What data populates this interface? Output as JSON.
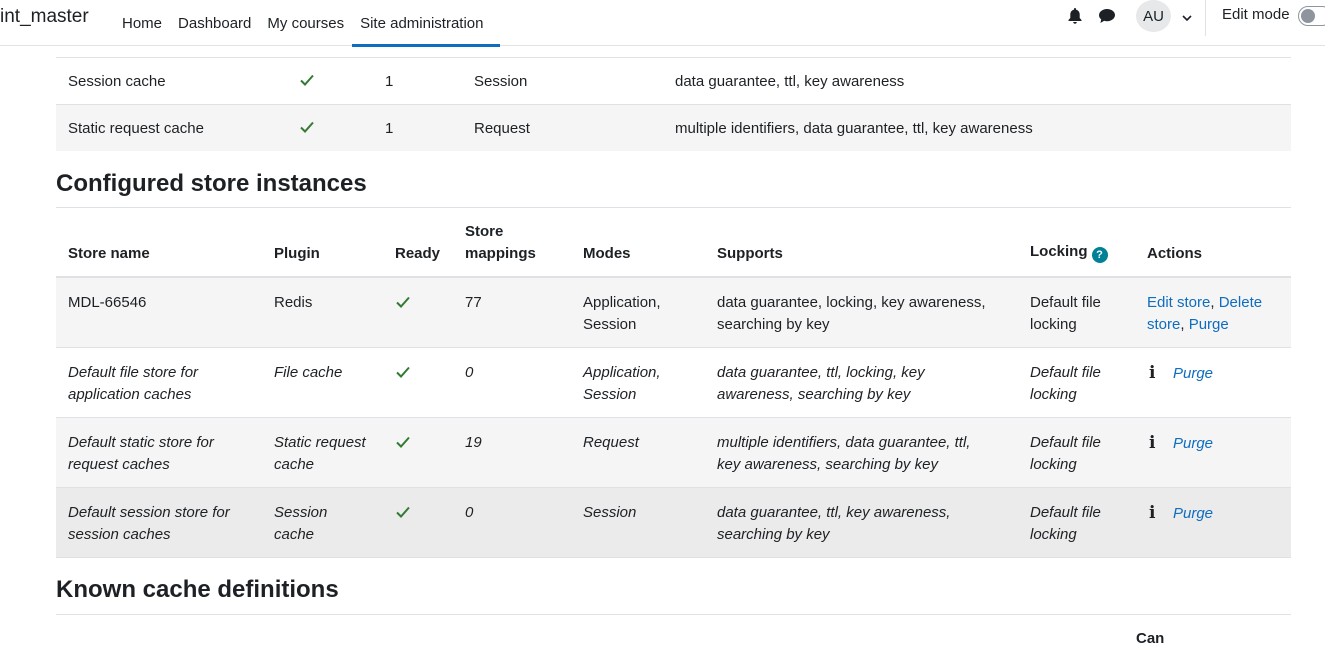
{
  "navbar": {
    "brand": "int_master",
    "items": [
      {
        "label": "Home"
      },
      {
        "label": "Dashboard"
      },
      {
        "label": "My courses"
      },
      {
        "label": "Site administration"
      }
    ],
    "avatar_initials": "AU",
    "edit_mode_label": "Edit mode",
    "accent_color": "#0f6cbf"
  },
  "plugins_table_rows": [
    {
      "name": "Session cache",
      "ready": true,
      "stores": "1",
      "modes": "Session",
      "supports": "data guarantee, ttl, key awareness"
    },
    {
      "name": "Static request cache",
      "ready": true,
      "stores": "1",
      "modes": "Request",
      "supports": "multiple identifiers, data guarantee, ttl, key awareness"
    }
  ],
  "store_instances": {
    "heading": "Configured store instances",
    "headers": {
      "store_name": "Store name",
      "plugin": "Plugin",
      "ready": "Ready",
      "store_mappings_1": "Store",
      "store_mappings_2": "mappings",
      "modes": "Modes",
      "supports": "Supports",
      "locking": "Locking",
      "actions": "Actions"
    },
    "rows": [
      {
        "name_1": "MDL-66546",
        "name_2": "",
        "plugin_1": "Redis",
        "plugin_2": "",
        "mappings": "77",
        "modes_1": "Application,",
        "modes_2": "Session",
        "supports_1": "data guarantee, locking, key awareness,",
        "supports_2": "searching by key",
        "locking_1": "Default file",
        "locking_2": "locking",
        "action_edit": "Edit store",
        "action_delete_1": "Delete",
        "action_delete_2": "store",
        "action_purge": "Purge"
      },
      {
        "name_1": "Default file store for",
        "name_2": "application caches",
        "plugin_1": "File cache",
        "plugin_2": "",
        "mappings": "0",
        "modes_1": "Application,",
        "modes_2": "Session",
        "supports_1": "data guarantee, ttl, locking, key",
        "supports_2": "awareness, searching by key",
        "locking_1": "Default file",
        "locking_2": "locking",
        "action_purge": "Purge"
      },
      {
        "name_1": "Default static store for",
        "name_2": "request caches",
        "plugin_1": "Static request",
        "plugin_2": "cache",
        "mappings": "19",
        "modes_1": "Request",
        "modes_2": "",
        "supports_1": "multiple identifiers, data guarantee, ttl,",
        "supports_2": "key awareness, searching by key",
        "locking_1": "Default file",
        "locking_2": "locking",
        "action_purge": "Purge"
      },
      {
        "name_1": "Default session store for",
        "name_2": "session caches",
        "plugin_1": "Session",
        "plugin_2": "cache",
        "mappings": "0",
        "modes_1": "Session",
        "modes_2": "",
        "supports_1": "data guarantee, ttl, key awareness,",
        "supports_2": "searching by key",
        "locking_1": "Default file",
        "locking_2": "locking",
        "action_purge": "Purge"
      }
    ]
  },
  "definitions": {
    "heading": "Known cache definitions",
    "partial_header": "Can"
  },
  "colors": {
    "check": "#357a32",
    "help": "#008196",
    "link": "#0f6cbf"
  }
}
